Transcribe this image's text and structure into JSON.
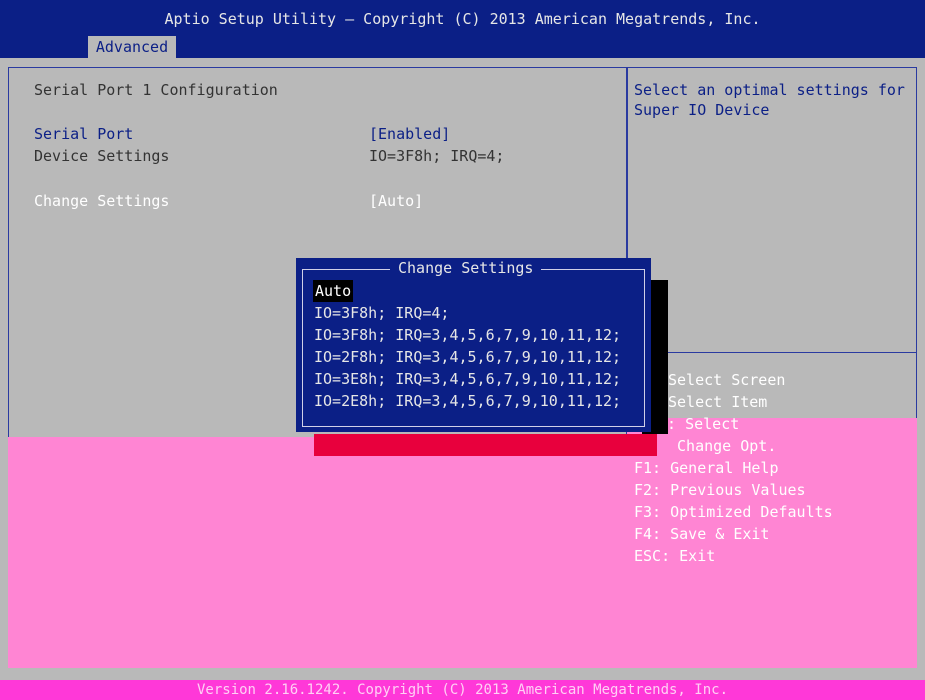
{
  "header": {
    "title": "Aptio Setup Utility – Copyright (C) 2013 American Megatrends, Inc.",
    "tab": "Advanced"
  },
  "main": {
    "section_title": "Serial Port 1 Configuration",
    "rows": [
      {
        "label": "Serial Port",
        "value": "[Enabled]"
      },
      {
        "label": "Device Settings",
        "value": "IO=3F8h; IRQ=4;"
      },
      {
        "label": "Change Settings",
        "value": "[Auto]"
      }
    ]
  },
  "help": {
    "description": "Select an optimal settings for\nSuper IO Device",
    "keys": [
      "Select Screen",
      "Select Item",
      "r: Select",
      " Change Opt.",
      "F1: General Help",
      "F2: Previous Values",
      "F3: Optimized Defaults",
      "F4: Save & Exit",
      "ESC: Exit"
    ]
  },
  "popup": {
    "title": "Change Settings",
    "options": [
      "Auto",
      "IO=3F8h; IRQ=4;",
      "IO=3F8h; IRQ=3,4,5,6,7,9,10,11,12;",
      "IO=2F8h; IRQ=3,4,5,6,7,9,10,11,12;",
      "IO=3E8h; IRQ=3,4,5,6,7,9,10,11,12;",
      "IO=2E8h; IRQ=3,4,5,6,7,9,10,11,12;"
    ],
    "selected_index": 0
  },
  "footer": {
    "text": "Version 2.16.1242. Copyright (C) 2013 American Megatrends, Inc."
  }
}
